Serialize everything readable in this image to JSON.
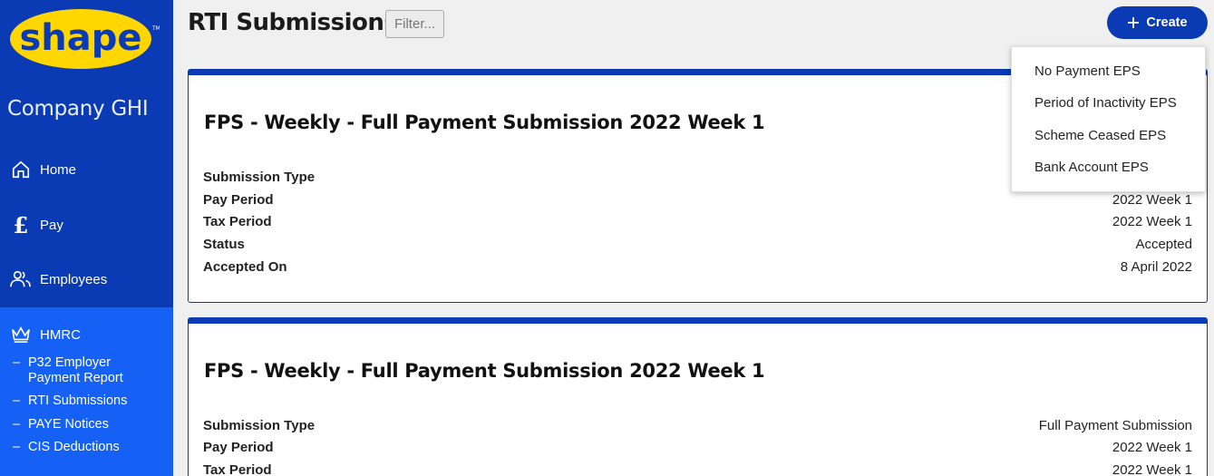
{
  "brand": {
    "logo_text": "shape",
    "company": "Company GHI",
    "accent": "#0a3bb5",
    "logo_yellow": "#ffd600"
  },
  "nav": {
    "items": [
      {
        "label": "Home",
        "icon": "home-icon"
      },
      {
        "label": "Pay",
        "icon": "pound-icon"
      },
      {
        "label": "Employees",
        "icon": "users-icon"
      },
      {
        "label": "HMRC",
        "icon": "crown-icon"
      }
    ],
    "hmrc_sub": [
      {
        "label_line1": "P32 Employer",
        "label_line2": "Payment Report"
      },
      {
        "label": "RTI Submissions"
      },
      {
        "label": "PAYE Notices"
      },
      {
        "label": "CIS Deductions"
      }
    ]
  },
  "header": {
    "title": "RTI Submissions",
    "filter_label": "Filter...",
    "create_label": "Create"
  },
  "create_menu": [
    "No Payment EPS",
    "Period of Inactivity EPS",
    "Scheme Ceased EPS",
    "Bank Account EPS"
  ],
  "submissions": [
    {
      "title": "FPS - Weekly - Full Payment Submission 2022 Week 1",
      "fields": [
        {
          "label": "Submission Type",
          "value": ""
        },
        {
          "label": "Pay Period",
          "value": "2022 Week 1"
        },
        {
          "label": "Tax Period",
          "value": "2022 Week 1"
        },
        {
          "label": "Status",
          "value": "Accepted"
        },
        {
          "label": "Accepted On",
          "value": "8 April 2022"
        }
      ]
    },
    {
      "title": "FPS - Weekly - Full Payment Submission 2022 Week 1",
      "fields": [
        {
          "label": "Submission Type",
          "value": "Full Payment Submission"
        },
        {
          "label": "Pay Period",
          "value": "2022 Week 1"
        },
        {
          "label": "Tax Period",
          "value": "2022 Week 1"
        }
      ]
    }
  ]
}
